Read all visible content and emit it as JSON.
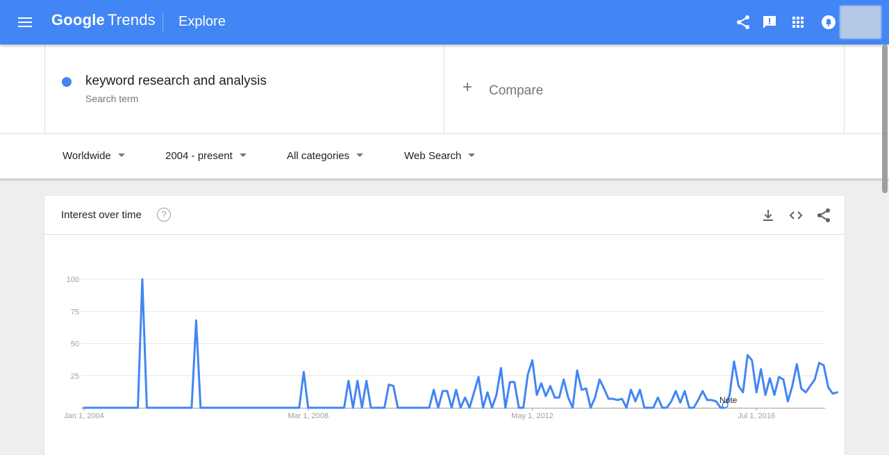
{
  "header": {
    "logo_google": "Google",
    "logo_trends": "Trends",
    "section_title": "Explore"
  },
  "search_term": {
    "term": "keyword research and analysis",
    "subtitle": "Search term",
    "color": "#4285f4"
  },
  "compare": {
    "plus": "+",
    "label": "Compare"
  },
  "filters": [
    {
      "label": "Worldwide"
    },
    {
      "label": "2004 - present"
    },
    {
      "label": "All categories"
    },
    {
      "label": "Web Search"
    }
  ],
  "card": {
    "title": "Interest over time",
    "help": "?"
  },
  "colors": {
    "header": "#4285f4",
    "series": "#4285f4"
  },
  "chart_data": {
    "type": "line",
    "x_range": [
      "2004-01",
      "2017-10"
    ],
    "ylim": [
      0,
      100
    ],
    "y_ticks": [
      "100",
      "75",
      "50",
      "25"
    ],
    "x_ticks": [
      "Jan 1, 2004",
      "Mar 1, 2008",
      "May 1, 2012",
      "Jul 1, 2016"
    ],
    "annotation": "Note",
    "series": [
      {
        "color": "#4285f4",
        "points": [
          [
            "2004-01",
            0
          ],
          [
            "2005-01",
            0
          ],
          [
            "2005-02",
            100
          ],
          [
            "2005-03",
            0
          ],
          [
            "2006-01",
            0
          ],
          [
            "2006-02",
            68
          ],
          [
            "2006-03",
            0
          ],
          [
            "2008-01",
            0
          ],
          [
            "2008-02",
            28
          ],
          [
            "2008-03",
            0
          ],
          [
            "2008-11",
            0
          ],
          [
            "2008-12",
            21
          ],
          [
            "2009-01",
            0
          ],
          [
            "2009-02",
            21
          ],
          [
            "2009-03",
            0
          ],
          [
            "2009-04",
            21
          ],
          [
            "2009-05",
            0
          ],
          [
            "2009-08",
            0
          ],
          [
            "2009-09",
            18
          ],
          [
            "2009-10",
            17
          ],
          [
            "2009-11",
            0
          ],
          [
            "2010-06",
            0
          ],
          [
            "2010-07",
            14
          ],
          [
            "2010-08",
            0
          ],
          [
            "2010-09",
            13
          ],
          [
            "2010-10",
            13
          ],
          [
            "2010-11",
            0
          ],
          [
            "2010-12",
            14
          ],
          [
            "2011-01",
            0
          ],
          [
            "2011-02",
            8
          ],
          [
            "2011-03",
            0
          ],
          [
            "2011-05",
            24
          ],
          [
            "2011-06",
            0
          ],
          [
            "2011-07",
            12
          ],
          [
            "2011-08",
            0
          ],
          [
            "2011-09",
            10
          ],
          [
            "2011-10",
            31
          ],
          [
            "2011-11",
            0
          ],
          [
            "2011-12",
            20
          ],
          [
            "2012-01",
            20
          ],
          [
            "2012-02",
            0
          ],
          [
            "2012-03",
            0
          ],
          [
            "2012-04",
            26
          ],
          [
            "2012-05",
            37
          ],
          [
            "2012-06",
            10
          ],
          [
            "2012-07",
            19
          ],
          [
            "2012-08",
            9
          ],
          [
            "2012-09",
            17
          ],
          [
            "2012-10",
            8
          ],
          [
            "2012-11",
            8
          ],
          [
            "2012-12",
            22
          ],
          [
            "2013-01",
            8
          ],
          [
            "2013-02",
            0
          ],
          [
            "2013-03",
            29
          ],
          [
            "2013-04",
            14
          ],
          [
            "2013-05",
            15
          ],
          [
            "2013-06",
            0
          ],
          [
            "2013-07",
            8
          ],
          [
            "2013-08",
            22
          ],
          [
            "2013-09",
            15
          ],
          [
            "2013-10",
            7
          ],
          [
            "2013-11",
            7
          ],
          [
            "2013-12",
            6
          ],
          [
            "2014-01",
            7
          ],
          [
            "2014-02",
            0
          ],
          [
            "2014-03",
            14
          ],
          [
            "2014-04",
            5
          ],
          [
            "2014-05",
            14
          ],
          [
            "2014-06",
            0
          ],
          [
            "2014-07",
            0
          ],
          [
            "2014-08",
            0
          ],
          [
            "2014-09",
            8
          ],
          [
            "2014-10",
            0
          ],
          [
            "2014-11",
            0
          ],
          [
            "2014-12",
            5
          ],
          [
            "2015-01",
            13
          ],
          [
            "2015-02",
            4
          ],
          [
            "2015-03",
            13
          ],
          [
            "2015-04",
            0
          ],
          [
            "2015-05",
            0
          ],
          [
            "2015-06",
            6
          ],
          [
            "2015-07",
            13
          ],
          [
            "2015-08",
            6
          ],
          [
            "2015-09",
            6
          ],
          [
            "2015-10",
            5
          ],
          [
            "2015-11",
            0
          ],
          [
            "2015-12",
            0
          ],
          [
            "2016-01",
            10
          ],
          [
            "2016-02",
            36
          ],
          [
            "2016-03",
            17
          ],
          [
            "2016-04",
            12
          ],
          [
            "2016-05",
            41
          ],
          [
            "2016-06",
            37
          ],
          [
            "2016-07",
            12
          ],
          [
            "2016-08",
            30
          ],
          [
            "2016-09",
            10
          ],
          [
            "2016-10",
            23
          ],
          [
            "2016-11",
            10
          ],
          [
            "2016-12",
            24
          ],
          [
            "2017-01",
            22
          ],
          [
            "2017-02",
            5
          ],
          [
            "2017-03",
            17
          ],
          [
            "2017-04",
            34
          ],
          [
            "2017-05",
            15
          ],
          [
            "2017-06",
            12
          ],
          [
            "2017-07",
            17
          ],
          [
            "2017-08",
            22
          ],
          [
            "2017-09",
            35
          ],
          [
            "2017-10",
            33
          ],
          [
            "2017-11",
            16
          ],
          [
            "2017-12",
            11
          ],
          [
            "2018-01",
            12
          ]
        ]
      }
    ]
  }
}
